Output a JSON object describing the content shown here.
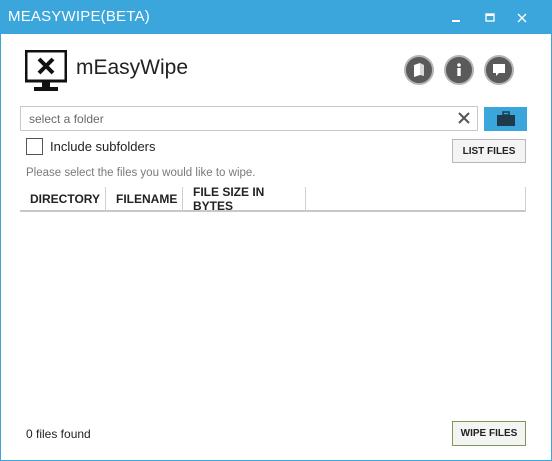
{
  "window": {
    "title": "MEASYWIPE(BETA)",
    "accent_color": "#3aa6db"
  },
  "header": {
    "app_name": "mEasyWipe",
    "logo_icon": "monitor-x-icon",
    "buttons": [
      {
        "name": "book-icon"
      },
      {
        "name": "info-icon"
      },
      {
        "name": "speech-bubble-icon"
      }
    ]
  },
  "folder": {
    "placeholder": "select a folder",
    "value": "",
    "clear_icon": "close-icon",
    "browse_icon": "briefcase-icon"
  },
  "options": {
    "include_subfolders_label": "Include subfolders",
    "include_subfolders_checked": false,
    "list_files_label": "LIST FILES"
  },
  "hint": "Please select the files you would like to wipe.",
  "table": {
    "columns": [
      "DIRECTORY",
      "FILENAME",
      "FILE SIZE IN BYTES"
    ],
    "rows": []
  },
  "footer": {
    "status": "0 files found",
    "wipe_label": "WIPE FILES"
  }
}
